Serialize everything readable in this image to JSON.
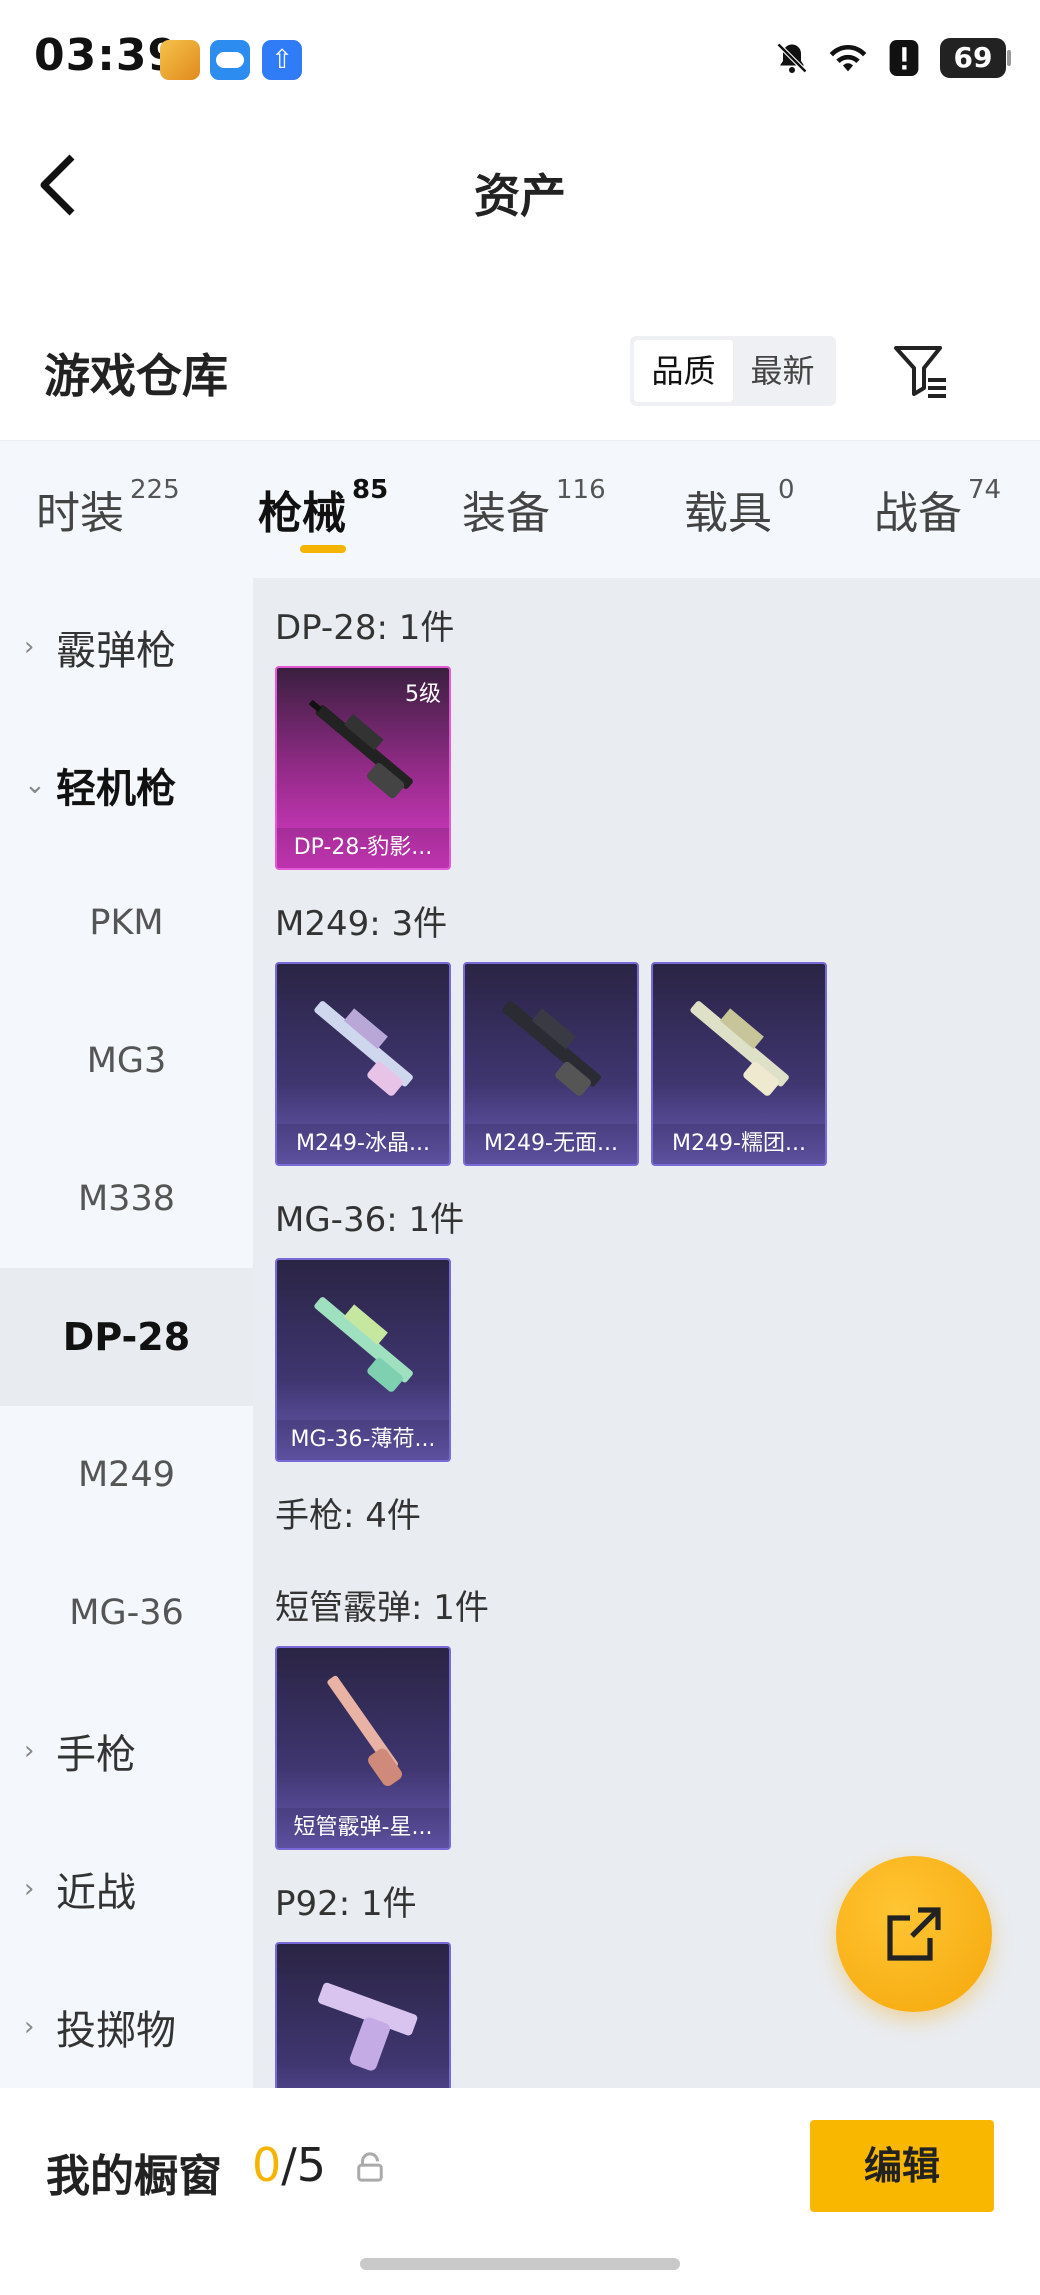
{
  "status_bar": {
    "time": "03:39",
    "battery": "69",
    "icons": [
      "game-app-icon",
      "weather-app-icon",
      "upload-app-icon",
      "mute-bell-icon",
      "wifi-icon",
      "alert-icon"
    ]
  },
  "header": {
    "title": "资产"
  },
  "section": {
    "title": "游戏仓库",
    "sort_options": [
      "品质",
      "最新"
    ],
    "active_sort": "品质"
  },
  "tabs": [
    {
      "label": "时装",
      "count": "225"
    },
    {
      "label": "枪械",
      "count": "85"
    },
    {
      "label": "装备",
      "count": "116"
    },
    {
      "label": "载具",
      "count": "0"
    },
    {
      "label": "战备",
      "count": "74"
    }
  ],
  "categories": [
    {
      "label": "霰弹枪",
      "type": "group"
    },
    {
      "label": "轻机枪",
      "type": "group-expanded"
    },
    {
      "label": "PKM",
      "type": "sub"
    },
    {
      "label": "MG3",
      "type": "sub"
    },
    {
      "label": "M338",
      "type": "sub"
    },
    {
      "label": "DP-28",
      "type": "sub-selected"
    },
    {
      "label": "M249",
      "type": "sub"
    },
    {
      "label": "MG-36",
      "type": "sub"
    },
    {
      "label": "手枪",
      "type": "group"
    },
    {
      "label": "近战",
      "type": "group"
    },
    {
      "label": "投掷物",
      "type": "group"
    }
  ],
  "groups": [
    {
      "title": "DP-28: 1件",
      "items": [
        {
          "name": "DP-28-豹影...",
          "level": "5级",
          "rarity": "pink"
        }
      ]
    },
    {
      "title": "M249: 3件",
      "items": [
        {
          "name": "M249-冰晶...",
          "rarity": "purple"
        },
        {
          "name": "M249-无面...",
          "rarity": "purple"
        },
        {
          "name": "M249-糯团...",
          "rarity": "purple"
        }
      ]
    },
    {
      "title": "MG-36: 1件",
      "items": [
        {
          "name": "MG-36-薄荷...",
          "rarity": "purple"
        }
      ]
    },
    {
      "title": "手枪: 4件",
      "items": []
    },
    {
      "title": "短管霰弹: 1件",
      "items": [
        {
          "name": "短管霰弹-星...",
          "rarity": "purple"
        }
      ]
    },
    {
      "title": "P92: 1件",
      "items": [
        {
          "name": "",
          "rarity": "purple"
        }
      ]
    }
  ],
  "bottom": {
    "showcase_title": "我的橱窗",
    "showcase_current": "0",
    "showcase_total": "/5",
    "edit_label": "编辑"
  },
  "colors": {
    "accent": "#f5b400",
    "rarity_purple": "#7a6ad8",
    "rarity_pink": "#e25bd4"
  }
}
